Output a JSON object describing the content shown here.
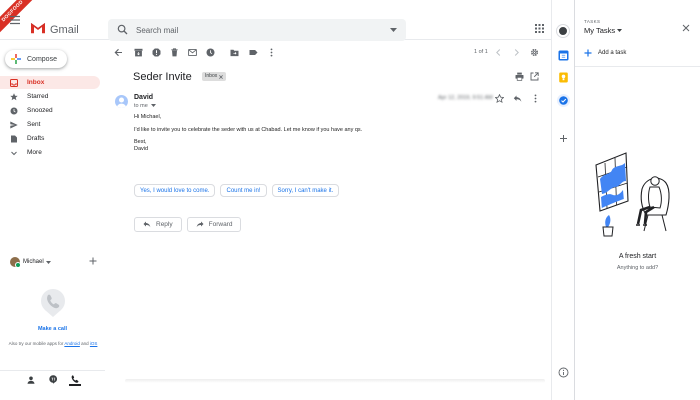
{
  "header": {
    "dev_ribbon": "DOGFOOD",
    "product_name": "Gmail",
    "search_placeholder": "Search mail"
  },
  "sidebar": {
    "compose_label": "Compose",
    "items": [
      {
        "label": "Inbox",
        "icon": "inbox-icon",
        "active": true
      },
      {
        "label": "Starred",
        "icon": "star-icon"
      },
      {
        "label": "Snoozed",
        "icon": "clock-icon"
      },
      {
        "label": "Sent",
        "icon": "send-icon"
      },
      {
        "label": "Drafts",
        "icon": "draft-icon"
      },
      {
        "label": "More",
        "icon": "chevron-down-icon"
      }
    ],
    "hangouts_user": "Michael",
    "make_call_label": "Make a call",
    "mobile_note_prefix": "Also try our mobile apps for ",
    "mobile_android": "Android",
    "mobile_and": " and ",
    "mobile_ios": "iOS"
  },
  "toolbar": {
    "pager_text": "1 of 1"
  },
  "message": {
    "subject": "Seder Invite",
    "label_chip": "Inbox",
    "sender": "David",
    "to_line": "to me",
    "date_blurred": "Apr 12, 2019, 9:51 AM",
    "greeting": "Hi Michael,",
    "body": "I'd like to invite you to celebrate the seder with us at Chabad. Let me know if you have any qs.",
    "signoff": "Best,\nDavid",
    "smart_replies": [
      "Yes, I would love to come.",
      "Count me in!",
      "Sorry, I can't make it."
    ],
    "reply_label": "Reply",
    "forward_label": "Forward"
  },
  "tasks": {
    "panel_label": "TASKS",
    "list_title": "My Tasks",
    "add_task_label": "Add a task",
    "empty_title": "A fresh start",
    "empty_subtitle": "Anything to add?"
  },
  "colors": {
    "accent": "#1a73e8",
    "gmail_red": "#d93025",
    "active_nav_bg": "#fce8e6",
    "keep_yellow": "#fbbc04",
    "calendar_blue": "#4285f4"
  }
}
